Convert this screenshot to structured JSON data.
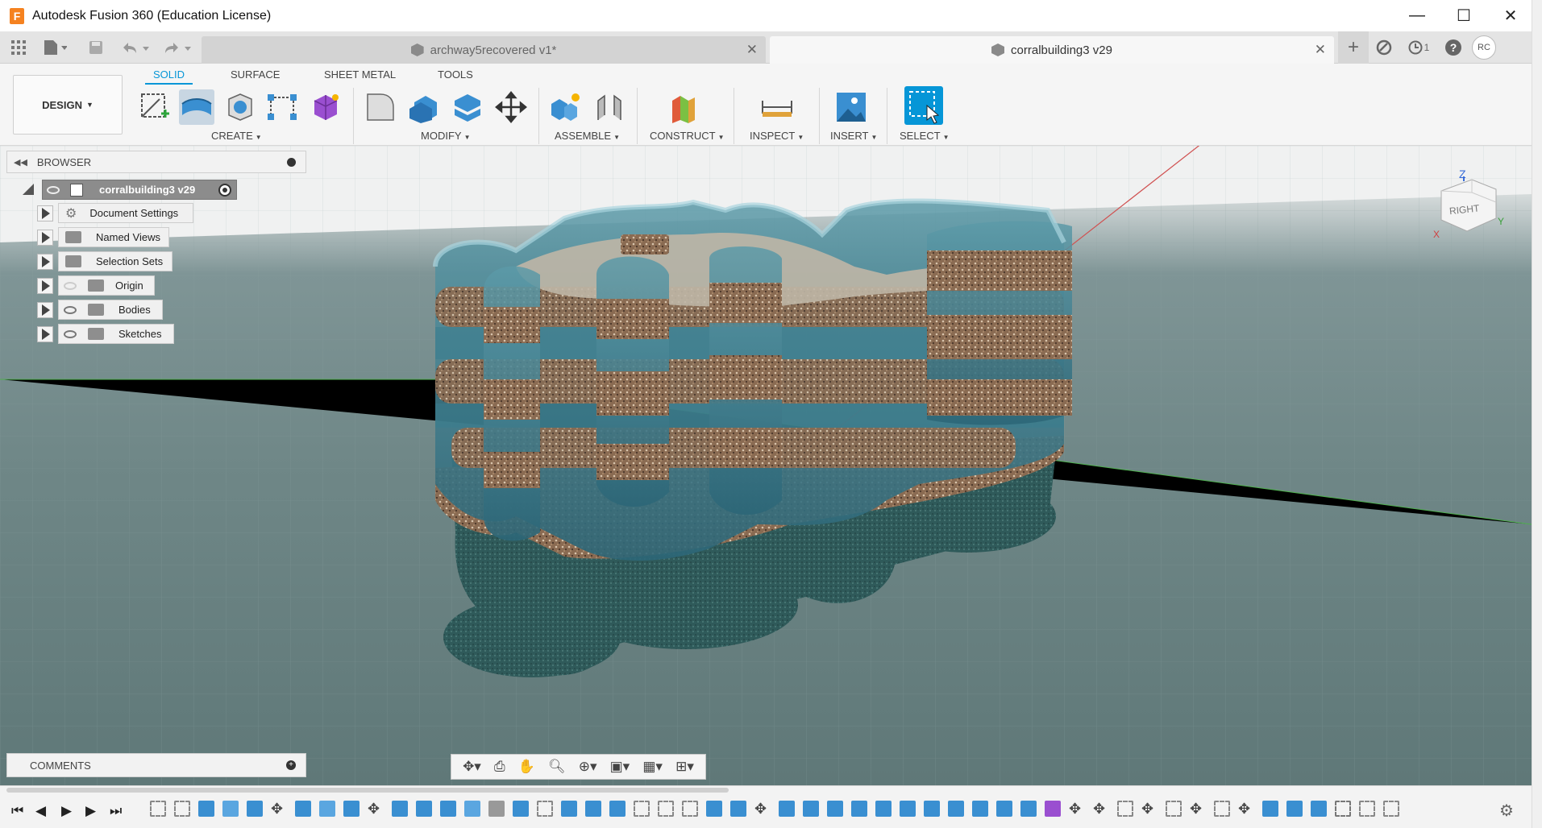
{
  "window": {
    "title": "Autodesk Fusion 360 (Education License)",
    "logo_letter": "F",
    "minimize": "—",
    "maximize": "☐",
    "close": "✕"
  },
  "tabs": [
    {
      "label": "archway5recovered v1*",
      "active": false
    },
    {
      "label": "corralbuilding3 v29",
      "active": true
    }
  ],
  "tab_close": "✕",
  "tabbar_right": {
    "job_count": "1",
    "help": "?",
    "user_initials": "RC",
    "new_tab": "+"
  },
  "toolbar": {
    "workspace": "DESIGN",
    "workspace_tabs": [
      "SOLID",
      "SURFACE",
      "SHEET METAL",
      "TOOLS"
    ],
    "groups": [
      "CREATE",
      "MODIFY",
      "ASSEMBLE",
      "CONSTRUCT",
      "INSPECT",
      "INSERT",
      "SELECT"
    ]
  },
  "browser": {
    "title": "BROWSER",
    "root": "corralbuilding3 v29",
    "items": [
      "Document Settings",
      "Named Views",
      "Selection Sets",
      "Origin",
      "Bodies",
      "Sketches"
    ]
  },
  "comments": {
    "title": "COMMENTS"
  },
  "viewcube": {
    "face": "RIGHT",
    "z": "Z",
    "x": "X",
    "y": "Y"
  },
  "colors": {
    "accent": "#0696d7",
    "ground": "#6f8787",
    "water_glass": "#3f7d8c",
    "stone": "#8a6b52",
    "granite": "#2f5a5a"
  }
}
